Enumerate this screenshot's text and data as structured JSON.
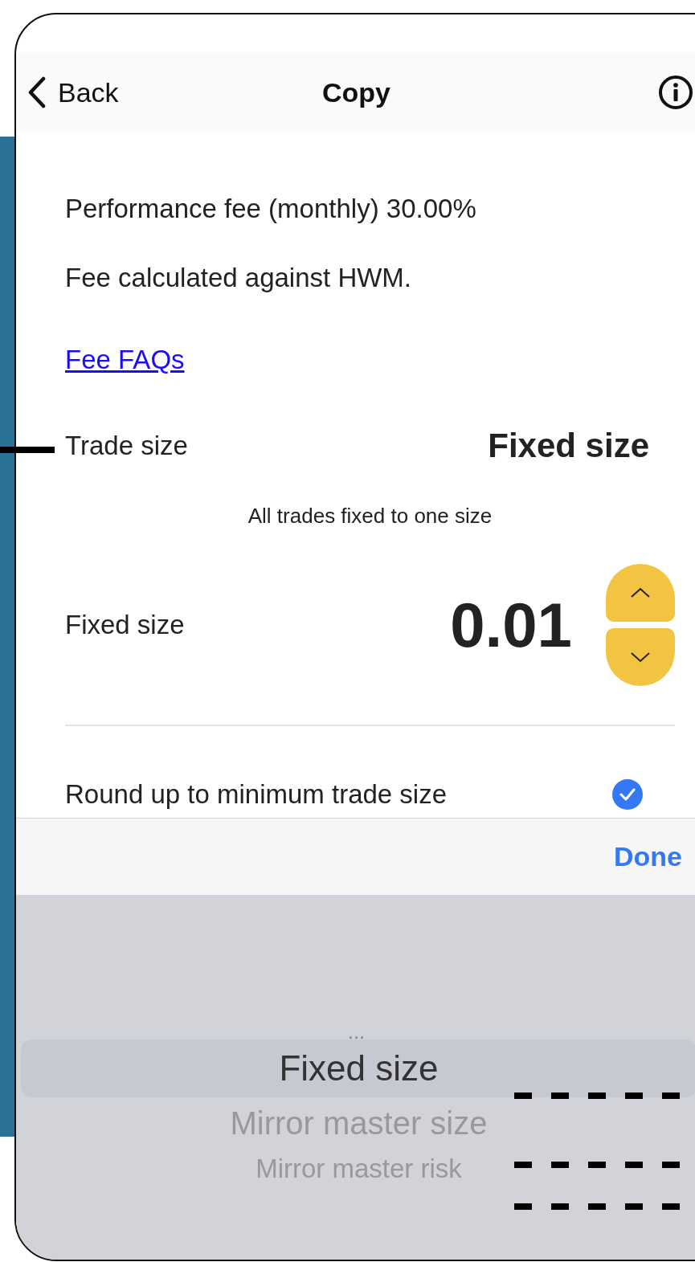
{
  "header": {
    "back": "Back",
    "title": "Copy"
  },
  "fee_lines": [
    "Performance fee (monthly) 30.00%",
    "Fee calculated against HWM."
  ],
  "fee_link": "Fee FAQs",
  "trade_size": {
    "label": "Trade size",
    "value": "Fixed size",
    "hint": "All trades fixed to one size"
  },
  "fixed_size": {
    "label": "Fixed size",
    "value": "0.01"
  },
  "round_up": {
    "label": "Round up to minimum trade size",
    "checked": true
  },
  "toolbar": {
    "done": "Done"
  },
  "picker": {
    "more": "...",
    "options": [
      {
        "label": "Fixed size",
        "selected": true
      },
      {
        "label": "Mirror master size",
        "selected": false
      },
      {
        "label": "Mirror master risk",
        "selected": false
      }
    ]
  }
}
